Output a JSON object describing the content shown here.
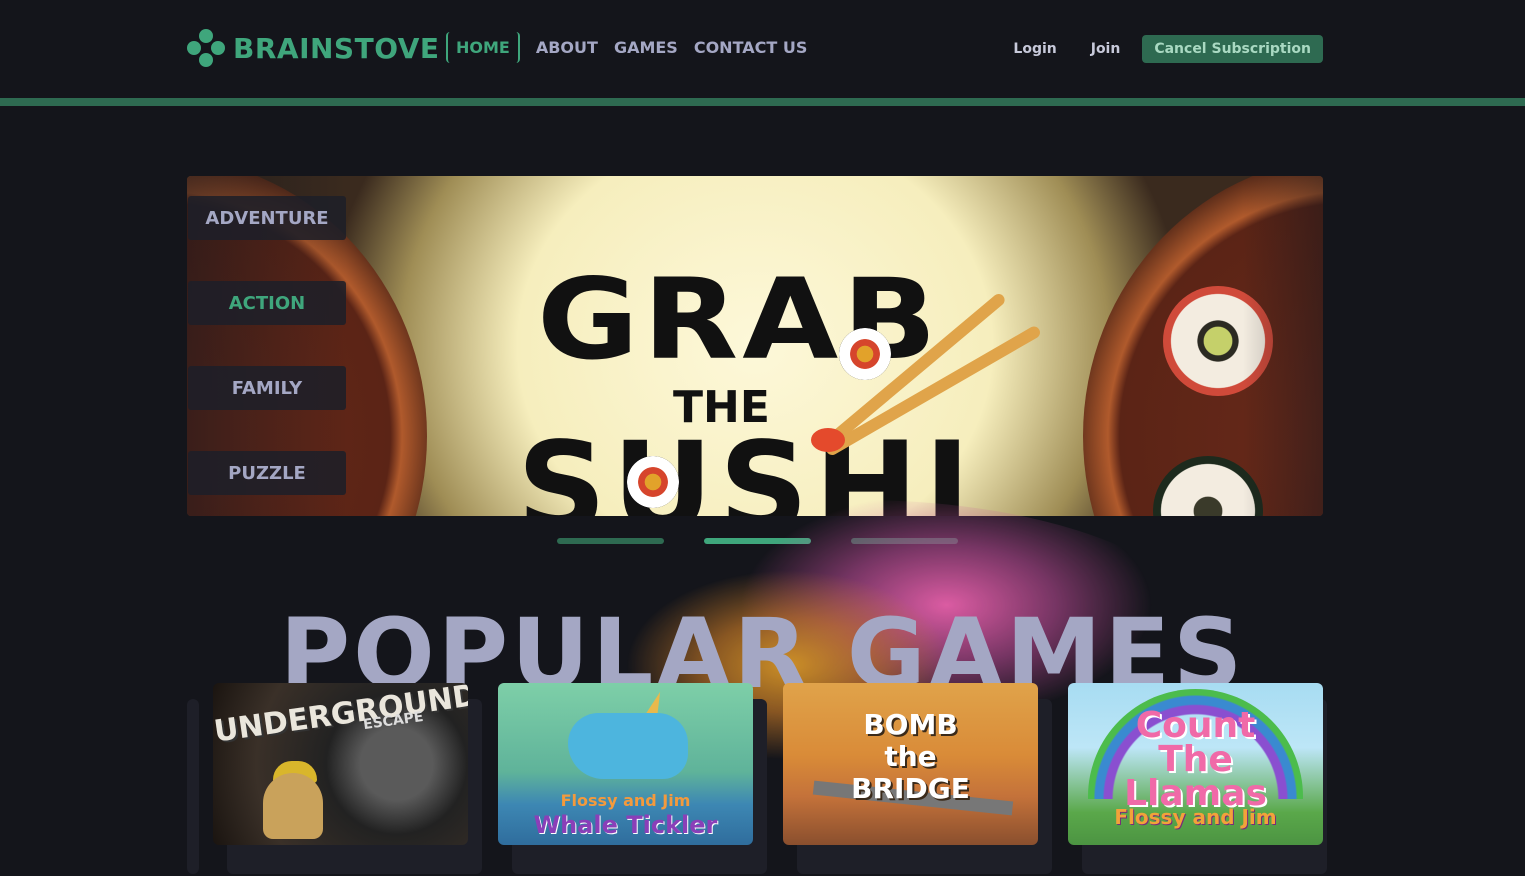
{
  "brand": {
    "name": "BRAINSTOVE"
  },
  "nav": {
    "items": [
      {
        "label": "HOME",
        "active": true
      },
      {
        "label": "ABOUT",
        "active": false
      },
      {
        "label": "GAMES",
        "active": false
      },
      {
        "label": "CONTACT US",
        "active": false
      }
    ]
  },
  "auth": {
    "login_label": "Login",
    "join_label": "Join",
    "cancel_label": "Cancel Subscription"
  },
  "hero": {
    "title_line1": "GRAB",
    "title_line2": "THE",
    "title_line3": "SUSHI",
    "categories": [
      {
        "label": "ADVENTURE",
        "active": false
      },
      {
        "label": "ACTION",
        "active": true
      },
      {
        "label": "FAMILY",
        "active": false
      },
      {
        "label": "PUZZLE",
        "active": false
      }
    ],
    "slides": {
      "count": 3,
      "active_index": 1
    }
  },
  "popular": {
    "title": "POPULAR GAMES",
    "games": [
      {
        "title": "UNDERGROUND",
        "subtitle": "ESCAPE"
      },
      {
        "title": "Whale Tickler",
        "subtitle": "Flossy and Jim"
      },
      {
        "title": "BOMB\nthe\nBRIDGE",
        "subtitle": ""
      },
      {
        "title": "Count\nThe\nLlamas",
        "subtitle": "Flossy and Jim"
      }
    ]
  },
  "colors": {
    "accent": "#3fa67c",
    "accent_dark": "#2e6a51",
    "text": "#a4a7c4",
    "background": "#14151b"
  }
}
